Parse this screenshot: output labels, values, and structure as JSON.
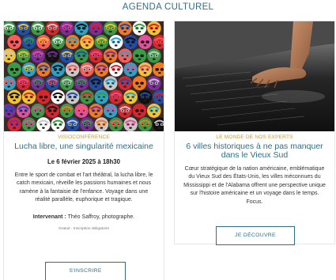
{
  "section": {
    "title": "AGENDA CULTUREL"
  },
  "events": [
    {
      "category": "VISIOCONFÉRENCE",
      "headline": "Lucha libre, une singularité mexicaine",
      "date": "Le 6 février 2025 à 18h30",
      "description": "Entre le sport de combat et l'art théâtral, la lucha libre, le catch mexicain, réveille les passions humaines et nous ramène à la fantaisie de l'enfance. Voyage dans une réalité parallèle, euphorique et tragique.",
      "speaker_label": "Intervenant :",
      "speaker_value": "Théo Saffroy, photographe.",
      "fine_print": "Gratuit - Inscription obligatoire",
      "cta": "S'INSCRIRE",
      "image": "lucha-libre-masks-photo"
    },
    {
      "category": "LE MONDE DE NOS EXPERTS",
      "headline": "6 villes historiques à ne pas manquer dans le Vieux Sud",
      "description": "Cœur stratégique de la nation américaine, emblématique du Vieux Sud des États-Unis, les villes méconnues du Mississippi et de l'Alabama offrent une perspective unique sur l'histoire américaine et un voyage dans le temps. Focus.",
      "cta": "JE DÉCOUVRE",
      "image": "memorial-hand-photo"
    }
  ],
  "colors": {
    "accent": "#2f6f86",
    "category": "#c49a4a",
    "text": "#333333"
  }
}
